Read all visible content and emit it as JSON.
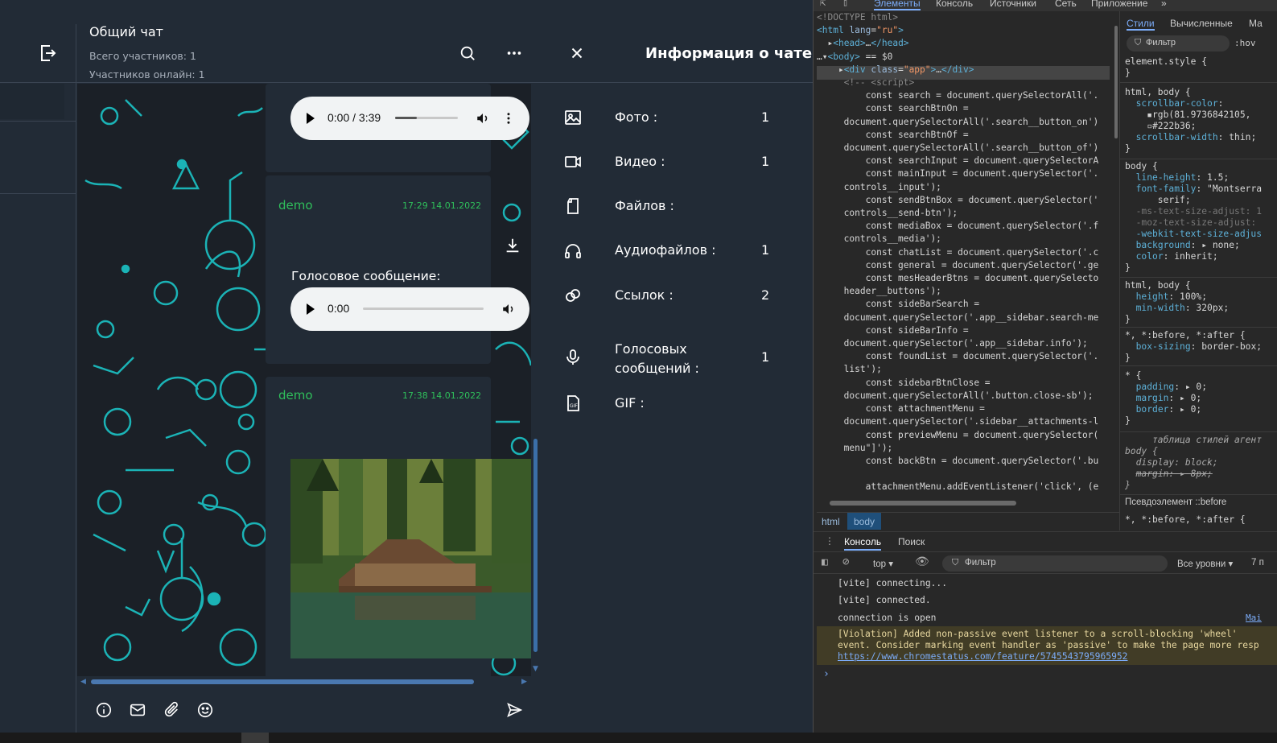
{
  "chat": {
    "title": "Общий чат",
    "members_total": "Всего участников:  1",
    "members_online": "Участников онлайн:  1"
  },
  "info_panel": {
    "title": "Информация о чате",
    "rows": [
      {
        "icon": "image-icon",
        "label": "Фото :",
        "count": "1"
      },
      {
        "icon": "video-icon",
        "label": "Видео :",
        "count": "1"
      },
      {
        "icon": "file-icon",
        "label": "Файлов :",
        "count": ""
      },
      {
        "icon": "headphones-icon",
        "label": "Аудиофайлов :",
        "count": "1"
      },
      {
        "icon": "link-icon",
        "label": "Ссылок :",
        "count": "2"
      },
      {
        "icon": "microphone-icon",
        "label": "Голосовых\nсообщений :",
        "count": "1"
      },
      {
        "icon": "gif-icon",
        "label": "GIF :",
        "count": ""
      }
    ]
  },
  "messages": [
    {
      "player_time": "0:00 / 3:39",
      "progress": 0.35
    },
    {
      "author": "demo",
      "time": "17:29 14.01.2022",
      "text": "Голосовое сообщение:",
      "player_time": "0:00"
    },
    {
      "author": "demo",
      "time": "17:38 14.01.2022"
    }
  ],
  "devtools": {
    "tabs": [
      "Элементы",
      "Консоль",
      "Источники",
      "Сеть",
      "Приложение"
    ],
    "styles_tabs": [
      "Стили",
      "Вычисленные",
      "Ма"
    ],
    "styles_filter": "Фильтр",
    "hov": ":hov",
    "breadcrumbs": [
      "html",
      "body"
    ],
    "console_tabs": [
      "Консоль",
      "Поиск"
    ],
    "context": "top",
    "console_filter": "Фильтр",
    "levels": "Все уровни",
    "issues": "7 п",
    "console_lines": [
      "[vite] connecting...",
      "[vite] connected.",
      "connection is open"
    ],
    "violation_text_1": "[Violation] Added non-passive event listener to a scroll-blocking 'wheel'",
    "violation_text_2": "event. Consider marking event handler as 'passive' to make the page more resp",
    "violation_link": "https://www.chromestatus.com/feature/5745543795965952",
    "source_link": "Mai",
    "pseudo_label": "Псевдоэлемент ::before"
  }
}
